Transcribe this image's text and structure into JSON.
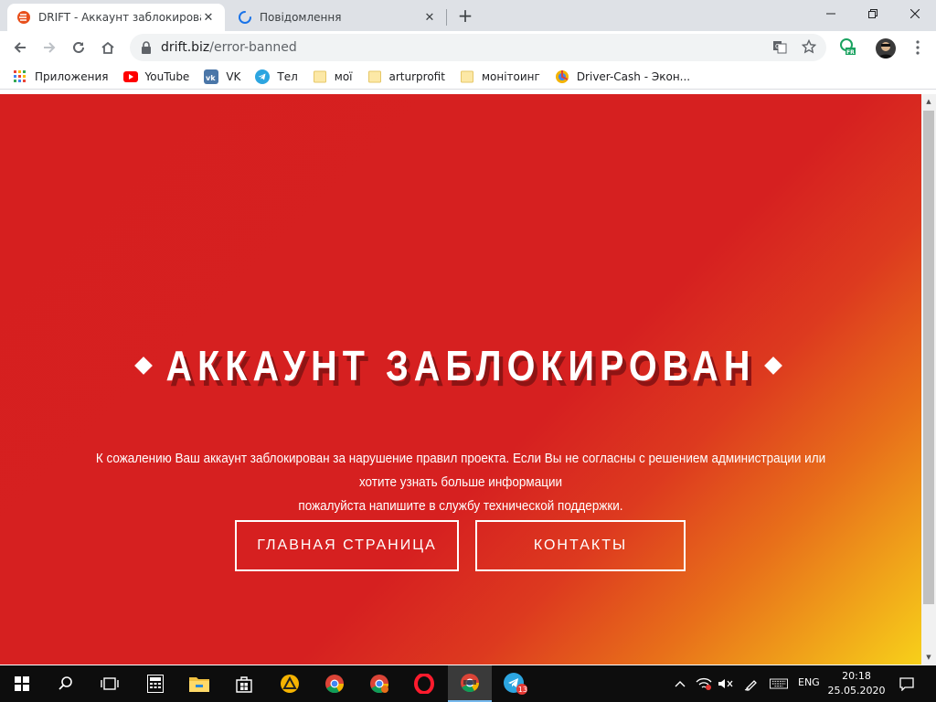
{
  "browser": {
    "tabs": [
      {
        "title": "DRIFT - Аккаунт заблокирован",
        "active": true,
        "favicon": "drift-logo-icon"
      },
      {
        "title": "Повідомлення",
        "active": false,
        "favicon": "loading-spinner-icon"
      }
    ],
    "url": {
      "host": "drift.biz",
      "path": "/error-banned"
    },
    "profile_badge": "FR"
  },
  "bookmarks": [
    {
      "label": "Приложения",
      "icon": "apps-grid-icon"
    },
    {
      "label": "YouTube",
      "icon": "youtube-icon"
    },
    {
      "label": "VK",
      "icon": "vk-icon"
    },
    {
      "label": "Тел",
      "icon": "telegram-icon"
    },
    {
      "label": "мої",
      "icon": "folder-icon"
    },
    {
      "label": "arturprofit",
      "icon": "folder-icon"
    },
    {
      "label": "монітоинг",
      "icon": "folder-icon"
    },
    {
      "label": "Driver-Cash - Экон...",
      "icon": "driver-cash-icon"
    }
  ],
  "page": {
    "title": "АККАУНТ ЗАБЛОКИРОВАН",
    "description_line1": "К сожалению Ваш аккаунт заблокирован за нарушение правил проекта. Если Вы не согласны с решением администрации или хотите узнать больше информации",
    "description_line2": "пожалуйста напишите в службу технической поддержки.",
    "buttons": {
      "home": "ГЛАВНАЯ СТРАНИЦА",
      "contacts": "КОНТАКТЫ"
    },
    "colors": {
      "background": "#d61f1f",
      "gradient_end": "#f7d01a",
      "title_shadow": "#8e1414"
    }
  },
  "taskbar": {
    "language": "ENG",
    "time": "20:18",
    "date": "25.05.2020",
    "telegram_badge": "13"
  }
}
